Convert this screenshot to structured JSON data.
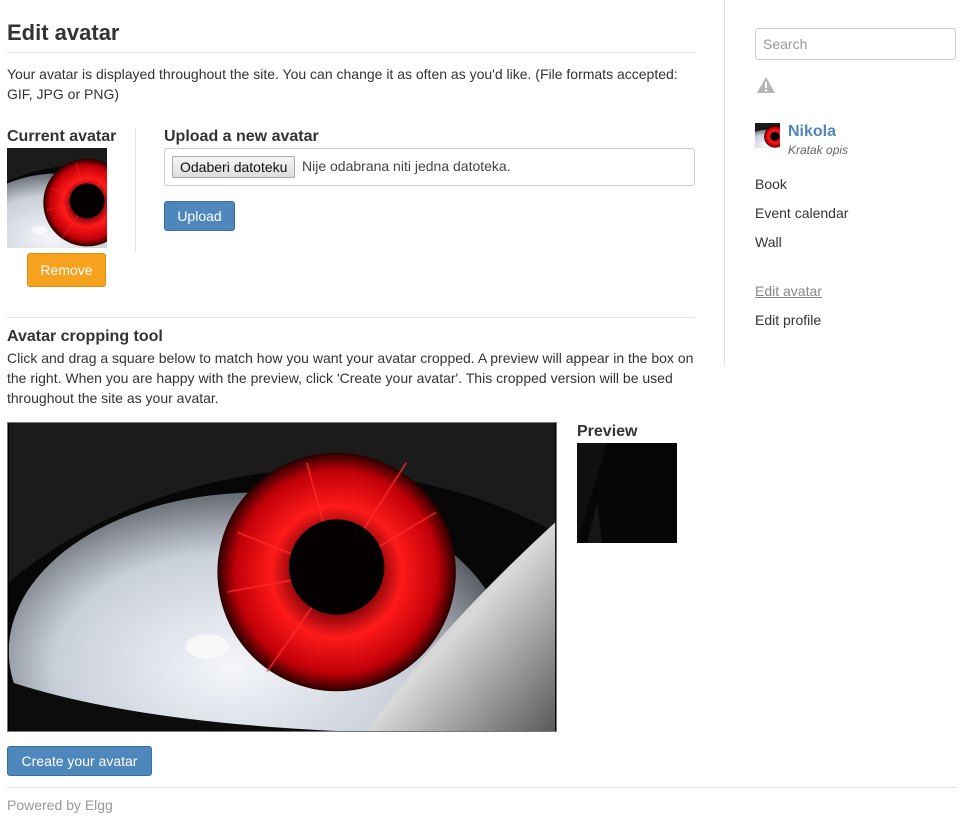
{
  "page": {
    "title": "Edit avatar",
    "intro": "Your avatar is displayed throughout the site. You can change it as often as you'd like. (File formats accepted: GIF, JPG or PNG)"
  },
  "current_avatar": {
    "heading": "Current avatar",
    "remove_label": "Remove"
  },
  "upload": {
    "heading": "Upload a new avatar",
    "choose_file_label": "Odaberi datoteku",
    "file_status": "Nije odabrana niti jedna datoteka.",
    "upload_label": "Upload"
  },
  "cropping": {
    "heading": "Avatar cropping tool",
    "description": "Click and drag a square below to match how you want your avatar cropped. A preview will appear in the box on the right. When you are happy with the preview, click 'Create your avatar'. This cropped version will be used throughout the site as your avatar.",
    "preview_heading": "Preview",
    "create_label": "Create your avatar"
  },
  "footer": {
    "text": "Powered by Elgg"
  },
  "sidebar": {
    "search_placeholder": "Search",
    "user_name": "Nikola",
    "user_description": "Kratak opis",
    "menu": [
      {
        "label": "Book"
      },
      {
        "label": "Event calendar"
      },
      {
        "label": "Wall"
      },
      {
        "label": "Edit avatar",
        "active": true
      },
      {
        "label": "Edit profile"
      }
    ]
  },
  "colors": {
    "accent_blue": "#4d87bc",
    "remove_orange": "#f7a21e",
    "iris_red": "#e0141a"
  },
  "icons": {
    "warning": "warning-icon"
  }
}
